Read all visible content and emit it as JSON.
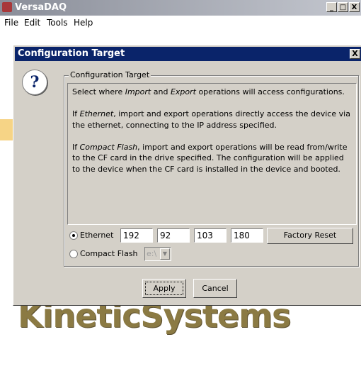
{
  "window": {
    "title": "VersaDAQ",
    "minimize": "_",
    "maximize": "□",
    "close": "X"
  },
  "menu": [
    "File",
    "Edit",
    "Tools",
    "Help"
  ],
  "background": {
    "logo_text": "KineticSystems"
  },
  "dialog": {
    "title": "Configuration Target",
    "close": "X",
    "icon": "question-icon",
    "icon_glyph": "?",
    "group_label": "Configuration Target",
    "description": [
      "Select where Import and Export operations will access configurations.",
      "If Ethernet, import and export operations directly access the device via the ethernet, connecting to the IP address specified.",
      "If Compact Flash, import and export operations will be read from/write to the CF card in the drive specified. The configuration will be applied to the device when the CF card is installed in the device and booted."
    ],
    "ethernet": {
      "label": "Ethernet",
      "selected": true,
      "ip": [
        "192",
        "92",
        "103",
        "180"
      ],
      "factory_reset": "Factory Reset"
    },
    "compact_flash": {
      "label": "Compact Flash",
      "selected": false,
      "drive": "e:\\",
      "dropdown_glyph": "▼"
    },
    "buttons": {
      "apply": "Apply",
      "cancel": "Cancel"
    }
  }
}
